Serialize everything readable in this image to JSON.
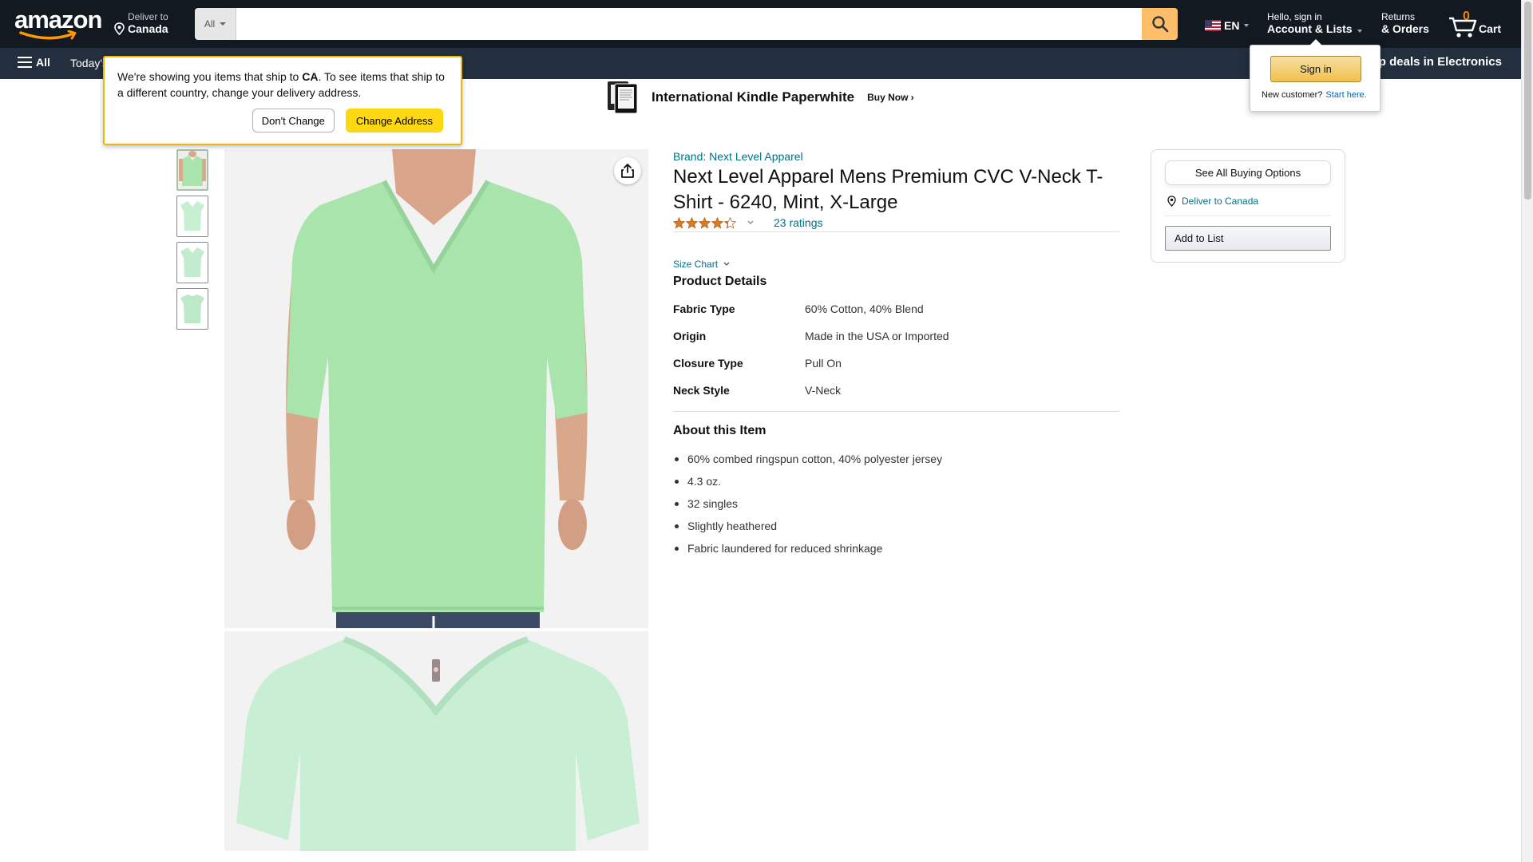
{
  "header": {
    "deliver_line1": "Deliver to",
    "deliver_line2": "Canada",
    "search_category": "All",
    "search_placeholder": "",
    "language": "EN",
    "account_line1": "Hello, sign in",
    "account_line2": "Account & Lists",
    "returns_line1": "Returns",
    "returns_line2": "& Orders",
    "cart_count": "0",
    "cart_label": "Cart"
  },
  "subnav": {
    "all_label": "All",
    "todays_label": "Today's",
    "promo_label": "op deals in Electronics"
  },
  "banner": {
    "title": "International Kindle Paperwhite",
    "cta": "Buy Now ›"
  },
  "ship_popover": {
    "text_before": "We're showing you items that ship to ",
    "country": "CA",
    "text_after": ". To see items that ship to a different country, change your delivery address.",
    "dont_change": "Don't Change",
    "change_address": "Change Address"
  },
  "signin_flyout": {
    "button": "Sign in",
    "new_customer": "New customer?",
    "start_here": "Start here."
  },
  "product": {
    "brand": "Brand: Next Level Apparel",
    "title": "Next Level Apparel Mens Premium CVC V-Neck T-Shirt - 6240, Mint, X-Large",
    "rating_value": 4.3,
    "ratings_count": "23 ratings",
    "size_chart": "Size Chart",
    "details_heading": "Product Details",
    "details": [
      {
        "key": "Fabric Type",
        "value": "60% Cotton, 40% Blend"
      },
      {
        "key": "Origin",
        "value": "Made in the USA or Imported"
      },
      {
        "key": "Closure Type",
        "value": "Pull On"
      },
      {
        "key": "Neck Style",
        "value": "V-Neck"
      }
    ],
    "about_heading": "About this Item",
    "bullets": [
      "60% combed ringspun cotton, 40% polyester jersey",
      "4.3 oz.",
      "32 singles",
      "Slightly heathered",
      "Fabric laundered for reduced shrinkage"
    ]
  },
  "buybox": {
    "see_all": "See All Buying Options",
    "deliver": "Deliver to Canada",
    "add_to_list": "Add to List"
  },
  "colors": {
    "nav_top": "#131921",
    "nav_sub": "#232f3e",
    "search_button": "#febd69",
    "link": "#007185",
    "star": "#de7921",
    "shirt_mint": "#a8e4ac"
  }
}
